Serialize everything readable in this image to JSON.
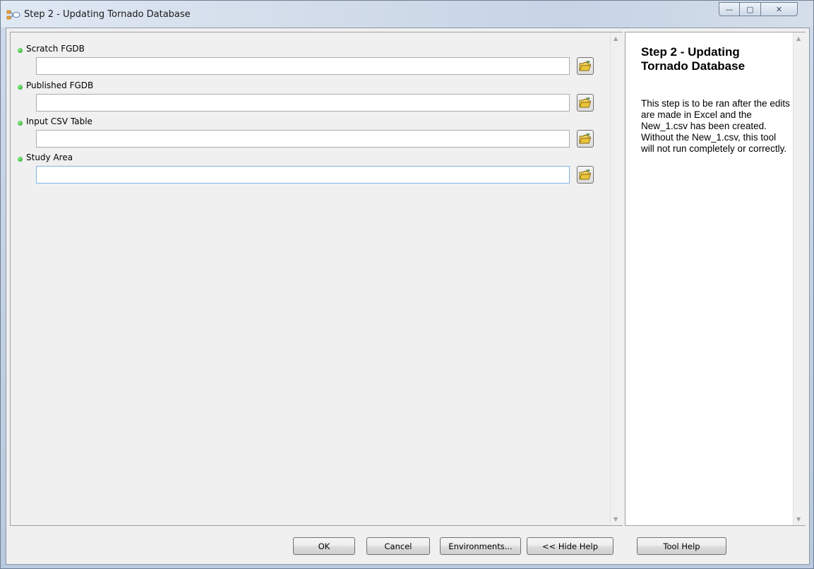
{
  "window": {
    "title": "Step 2 - Updating Tornado Database",
    "caption_buttons": {
      "minimize": "—",
      "maximize": "▢",
      "close": "✕"
    }
  },
  "parameters": [
    {
      "label": "Scratch FGDB",
      "value": "",
      "required_indicator": "green-dot"
    },
    {
      "label": "Published FGDB",
      "value": "",
      "required_indicator": "green-dot"
    },
    {
      "label": "Input CSV Table",
      "value": "",
      "required_indicator": "green-dot"
    },
    {
      "label": "Study Area",
      "value": "",
      "required_indicator": "green-dot"
    }
  ],
  "help": {
    "title": "Step 2 - Updating Tornado Database",
    "body": "This step is to be ran after the edits are made in Excel and the New_1.csv has been created. Without the New_1.csv, this tool will not run completely or correctly."
  },
  "buttons": {
    "ok": "OK",
    "cancel": "Cancel",
    "environments": "Environments...",
    "hide_help": "<< Hide Help",
    "tool_help": "Tool Help"
  },
  "icons": {
    "app": "model-tool-icon",
    "browse": "open-folder-icon",
    "required": "green-dot-icon"
  },
  "colors": {
    "required_dot": "#1a9f1a",
    "folder_icon": "#e9c43a"
  }
}
